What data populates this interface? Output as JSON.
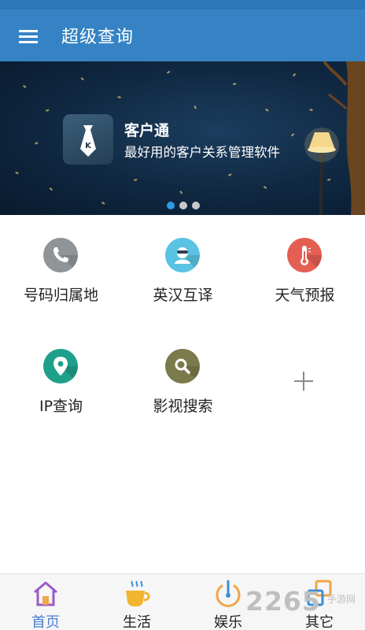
{
  "app_bar": {
    "title": "超级查询",
    "menu_icon": "hamburger-menu-icon"
  },
  "banner": {
    "app_name": "客户通",
    "subtitle": "最好用的客户关系管理软件",
    "icon": "necktie-k-icon",
    "dots": {
      "count": 3,
      "active_index": 0
    },
    "colors": {
      "background": "#0f2740",
      "active_dot": "#2a9be6",
      "inactive_dot": "#c8c8c8"
    }
  },
  "grid": {
    "items": [
      {
        "label": "号码归属地",
        "icon": "phone-icon",
        "color": "#8e9498"
      },
      {
        "label": "英汉互译",
        "icon": "translator-face-icon",
        "color": "#5ac2e2"
      },
      {
        "label": "天气预报",
        "icon": "thermometer-icon",
        "color": "#e55e52"
      },
      {
        "label": "IP查询",
        "icon": "location-pin-icon",
        "color": "#1fa08a"
      },
      {
        "label": "影视搜索",
        "icon": "magnifier-icon",
        "color": "#7a7a4c"
      }
    ],
    "add_icon": "plus-icon"
  },
  "bottom_nav": {
    "items": [
      {
        "label": "首页",
        "icon": "home-icon",
        "active": true
      },
      {
        "label": "生活",
        "icon": "coffee-cup-icon",
        "active": false
      },
      {
        "label": "娱乐",
        "icon": "power-clock-icon",
        "active": false
      },
      {
        "label": "其它",
        "icon": "other-squares-icon",
        "active": false
      }
    ],
    "active_color": "#4a7fd0"
  },
  "watermark": {
    "text": "2265",
    "sub": "手游网"
  },
  "colors": {
    "primary": "#3583c4"
  }
}
